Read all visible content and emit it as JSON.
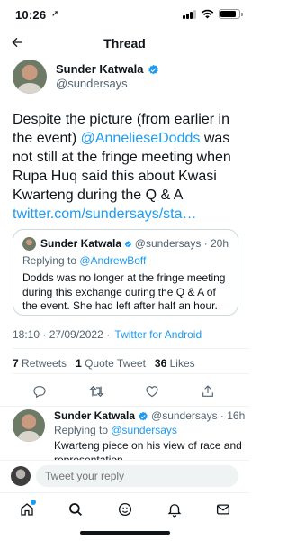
{
  "status_bar": {
    "time": "10:26",
    "location_glyph": "➚",
    "battery_level": 0.85
  },
  "header": {
    "title": "Thread"
  },
  "main_tweet": {
    "author_name": "Sunder Katwala",
    "handle": "@sundersays",
    "text_1": "Despite the picture (from earlier in the event) ",
    "mention": "@AnnelieseDodds",
    "text_2": " was not still at the fringe meeting when Rupa Huq said this about Kwasi Kwarteng during the Q & A",
    "link": "twitter.com/sundersays/sta…"
  },
  "quoted_tweet": {
    "author_name": "Sunder Katwala",
    "meta": "@sundersays · 20h",
    "replying_prefix": "Replying to ",
    "replying_handle": "@AndrewBoff",
    "text": "Dodds was no longer at the fringe meeting during this exchange during the Q & A of the event. She had left after half an hour."
  },
  "meta": {
    "timestamp": "18:10 · 27/09/2022 · ",
    "client": "Twitter for Android"
  },
  "stats": {
    "retweets_count": "7",
    "retweets_label": "Retweets",
    "quotes_count": "1",
    "quotes_label": "Quote Tweet",
    "likes_count": "36",
    "likes_label": "Likes"
  },
  "reply_tweet": {
    "author_name": "Sunder Katwala",
    "meta": "@sundersays · 16h",
    "replying_prefix": "Replying to ",
    "replying_handle": "@sundersays",
    "text": "Kwarteng piece on his view of race and representation"
  },
  "compose": {
    "placeholder": "Tweet your reply"
  },
  "icons": {
    "back": "back-arrow-icon",
    "verified": "verified-badge-icon",
    "reply": "reply-icon",
    "retweet": "retweet-icon",
    "like": "heart-icon",
    "share": "share-icon",
    "home": "home-icon",
    "search": "search-icon",
    "spaces": "spaces-icon",
    "notifications": "bell-icon",
    "messages": "mail-icon"
  },
  "colors": {
    "accent": "#1d9bf0",
    "text": "#0f1419",
    "secondary": "#536471"
  }
}
